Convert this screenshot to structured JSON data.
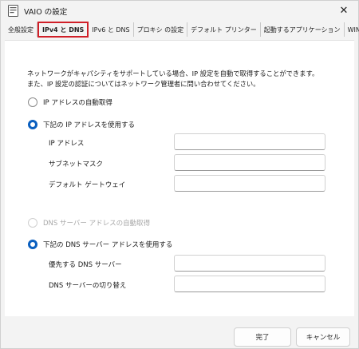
{
  "window": {
    "title": "VAIO の設定",
    "close_glyph": "✕"
  },
  "tabs": [
    {
      "label": "全般設定"
    },
    {
      "label": "IPv4 と DNS",
      "active": true
    },
    {
      "label": "IPv6 と DNS"
    },
    {
      "label": "プロキシ の設定"
    },
    {
      "label": "デフォルト プリンター"
    },
    {
      "label": "起動するアプリケーション"
    },
    {
      "label": "WINS"
    }
  ],
  "ipv4": {
    "description_line1": "ネットワークがキャパシティをサポートしている場合、IP 設定を自動で取得することができます。",
    "description_line2": "また、IP 設定の認証についてはネットワーク管理者に問い合わせてください。",
    "auto_ip_label": "IP アドレスの自動取得",
    "manual_ip_label": "下記の IP アドレスを使用する",
    "ip_address_label": "IP アドレス",
    "subnet_mask_label": "サブネットマスク",
    "default_gateway_label": "デフォルト ゲートウェイ",
    "ip_address_value": "",
    "subnet_mask_value": "",
    "default_gateway_value": ""
  },
  "dns": {
    "auto_dns_label": "DNS サーバー アドレスの自動取得",
    "manual_dns_label": "下記の DNS サーバー アドレスを使用する",
    "preferred_dns_label": "優先する DNS サーバー",
    "alternate_dns_label": "DNS サーバーの切り替え",
    "preferred_dns_value": "",
    "alternate_dns_value": ""
  },
  "buttons": {
    "ok_label": "完了",
    "cancel_label": "キャンセル"
  },
  "colors": {
    "accent": "#0a5fbf",
    "highlight_box": "#d01f28"
  }
}
